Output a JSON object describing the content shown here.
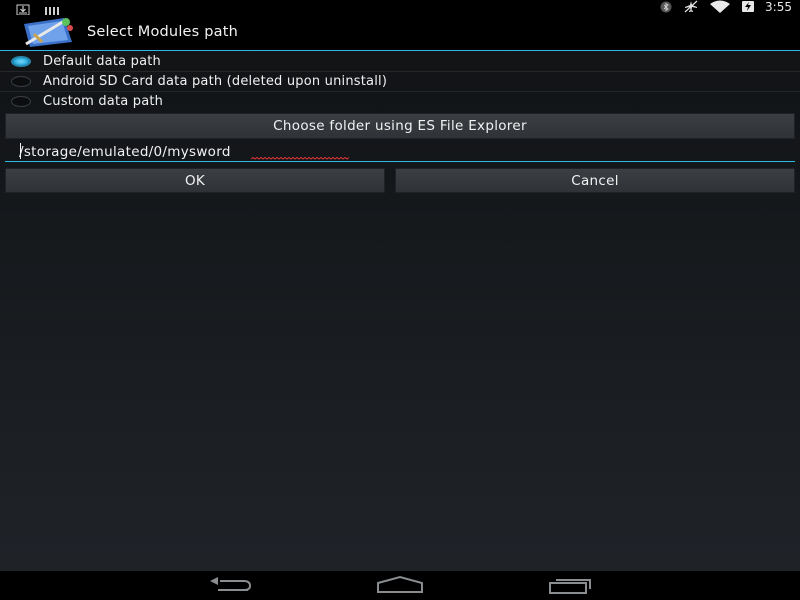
{
  "status_bar": {
    "time": "3:55",
    "icons": [
      "download-icon",
      "signal-bars-icon",
      "bluetooth-icon",
      "airplane-mode-icon",
      "wifi-icon",
      "battery-charging-icon"
    ]
  },
  "header": {
    "title": "Select Modules path",
    "app_icon": "mysword-app-icon"
  },
  "options": [
    {
      "label": "Default data path",
      "selected": true
    },
    {
      "label": "Android SD Card data path (deleted upon uninstall)",
      "selected": false
    },
    {
      "label": "Custom data path",
      "selected": false
    }
  ],
  "choose_button": {
    "label": "Choose folder using ES File Explorer"
  },
  "path_input": {
    "value": "/storage/emulated/0/mysword"
  },
  "dialog_buttons": {
    "ok": "OK",
    "cancel": "Cancel"
  },
  "nav_bar": {
    "icons": [
      "back-icon",
      "home-icon",
      "recent-apps-icon"
    ]
  },
  "colors": {
    "accent": "#33b5e5",
    "background": "#15181b",
    "button": "#35393d"
  }
}
